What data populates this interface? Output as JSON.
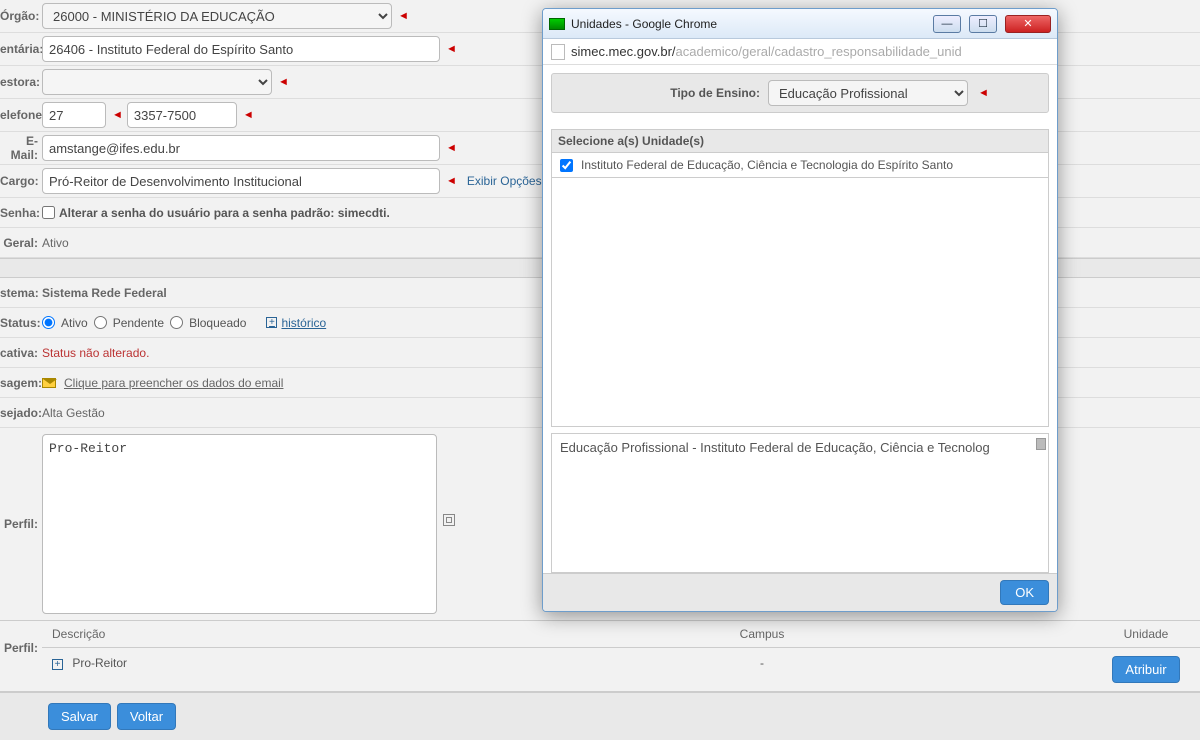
{
  "labels": {
    "orgao": "Órgão:",
    "entaria": "entária:",
    "estora": "estora:",
    "telefone": "elefone:",
    "email": "E-Mail:",
    "cargo": "Cargo:",
    "senha": "Senha:",
    "geral": "Geral:",
    "sistema": "stema:",
    "status": "Status:",
    "cativa": "cativa:",
    "sagem": "sagem:",
    "sejado": "sejado:",
    "perfil": "Perfil:",
    "perfil2": " Perfil:"
  },
  "orgao": {
    "value": "26000 - MINISTÉRIO DA EDUCAÇÃO"
  },
  "entaria": {
    "value": "26406 - Instituto Federal do Espírito Santo"
  },
  "estora": {
    "value": ""
  },
  "telefone": {
    "ddd": "27",
    "numero": "3357-7500"
  },
  "email": {
    "value": "amstange@ifes.edu.br"
  },
  "cargo": {
    "value": "Pró-Reitor de Desenvolvimento Institucional",
    "exibir": "Exibir Opções"
  },
  "senha": {
    "text": "Alterar a senha do usuário para a senha padrão: simecdti."
  },
  "geral": {
    "value": "Ativo"
  },
  "sistema": {
    "value": "Sistema Rede Federal"
  },
  "status": {
    "ativo": "Ativo",
    "pendente": "Pendente",
    "bloqueado": "Bloqueado",
    "historico": "histórico"
  },
  "cativa": {
    "value": "Status não alterado."
  },
  "sagem": {
    "value": "Clique para preencher os dados do email"
  },
  "sejado": {
    "value": "Alta Gestão"
  },
  "perfil": {
    "value": "Pro-Reitor"
  },
  "table": {
    "col_desc": "Descrição",
    "col_campus": "Campus",
    "col_unidade": "Unidade",
    "row_desc": "Pro-Reitor",
    "row_campus": "-",
    "btn_atribuir": "Atribuir"
  },
  "buttons": {
    "salvar": "Salvar",
    "voltar": "Voltar"
  },
  "req_marker": "◄",
  "popup": {
    "title": "Unidades - Google Chrome",
    "url_black": "simec.mec.gov.br/",
    "url_grey": "academico/geral/cadastro_responsabilidade_unid",
    "tipo_label": "Tipo de Ensino:",
    "tipo_value": "Educação Profissional",
    "sel_header": "Selecione a(s) Unidade(s)",
    "unit_name": "Instituto Federal de Educação, Ciência e Tecnologia do Espírito Santo",
    "result_line": "Educação Profissional - Instituto Federal de Educação, Ciência e Tecnolog",
    "ok": "OK"
  }
}
